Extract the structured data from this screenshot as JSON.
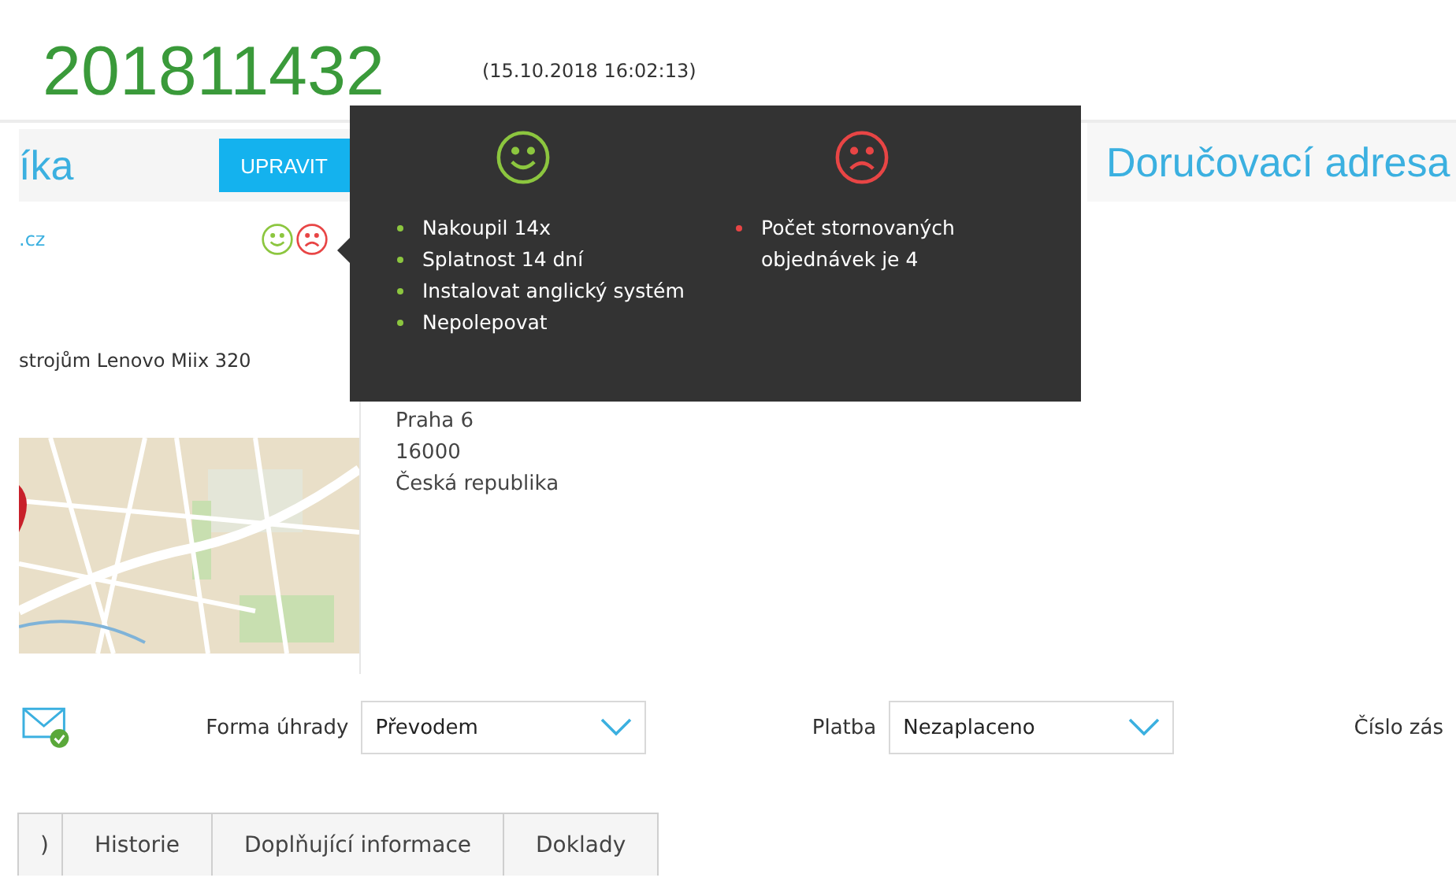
{
  "order": {
    "number": "201811432",
    "timestamp": "(15.10.2018 16:02:13)"
  },
  "customer_panel": {
    "heading": "íka",
    "edit_button": "UPRAVIT",
    "link": ".cz",
    "note": "strojům Lenovo Miix 320"
  },
  "billing_address": {
    "lines": [
      "Praha 6",
      "16000",
      "Česká republika"
    ]
  },
  "delivery_address": {
    "heading": "Doručovací adresa"
  },
  "rating_tooltip": {
    "columns": [
      {
        "kind": "positive",
        "color": "#8cc63f",
        "items": [
          "Nakoupil 14x",
          "Splatnost 14 dní",
          "Instalovat anglický systém",
          "Nepolepovat"
        ]
      },
      {
        "kind": "negative",
        "color": "#e84545",
        "items": [
          "Počet stornovaných objednávek je 4"
        ]
      }
    ]
  },
  "fields": [
    {
      "label": "Forma úhrady",
      "value": "Převodem"
    },
    {
      "label": "Platba",
      "value": "Nezaplaceno"
    },
    {
      "label": "Číslo zás"
    }
  ],
  "tabs": [
    {
      "label": ")",
      "selected": false
    },
    {
      "label": "Historie",
      "selected": false
    },
    {
      "label": "Doplňující informace",
      "selected": false
    },
    {
      "label": "Doklady",
      "selected": false
    }
  ]
}
